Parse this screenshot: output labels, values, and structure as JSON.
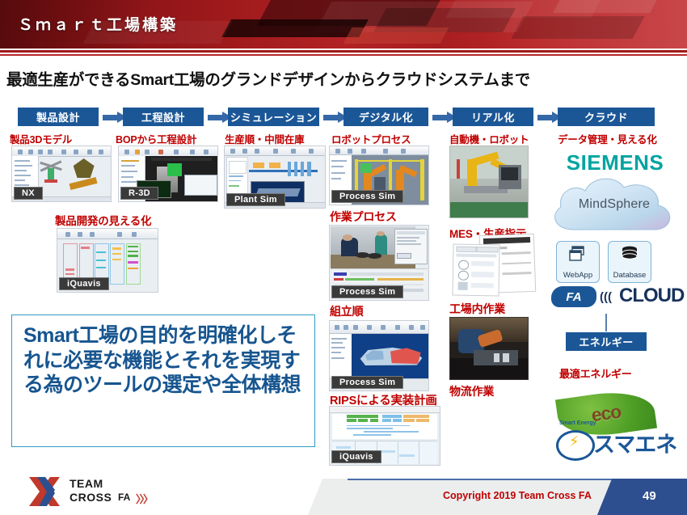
{
  "header": {
    "title": "Ｓｍａｒｔ工場構築"
  },
  "subtitle": "最適生産ができるSmart工場のグランドデザインからクラウドシステムまで",
  "process_steps": [
    {
      "label": "製品設計",
      "sublabel": "製品3Dモデル"
    },
    {
      "label": "工程設計",
      "sublabel": "BOPから工程設計"
    },
    {
      "label": "シミュレーション",
      "sublabel": "生産順・中間在庫"
    },
    {
      "label": "デジタル化",
      "sublabel": "ロボットプロセス"
    },
    {
      "label": "リアル化",
      "sublabel": "自動機・ロボット"
    },
    {
      "label": "クラウド",
      "sublabel": "データ管理・見える化"
    }
  ],
  "tool_tags": {
    "nx": "NX",
    "r3d": "R-3D",
    "plant_sim": "Plant Sim",
    "iquavis": "iQuavis",
    "process_sim": "Process Sim"
  },
  "section_labels": {
    "product_dev_visualization": "製品開発の見える化",
    "work_process": "作業プロセス",
    "assembly_order": "組立順",
    "rips_plan": "RIPSによる実装計画",
    "mes_production": "MES・生産指示",
    "factory_work": "工場内作業",
    "logistics_work": "物流作業",
    "energy_box": "エネルギー",
    "optimal_energy": "最適エネルギー"
  },
  "callout": {
    "text": "Smart工場の目的を明確化しそれに必要な機能とそれを実現する為のツールの選定や全体構想"
  },
  "cloud": {
    "siemens": "SIEMENS",
    "mindsphere": "MindSphere",
    "webapp": "WebApp",
    "database": "Database",
    "fa": "FA",
    "cloud_word": "CLOUD",
    "waves": "((("
  },
  "energy": {
    "eco": "eco",
    "sumaene": "スマエネ",
    "smart_energy": "Smart Energy"
  },
  "footer": {
    "copyright": "Copyright 2019 Team Cross FA",
    "page_number": "49",
    "logo_line1": "TEAM",
    "logo_line2": "CROSS",
    "logo_fa": "FA",
    "logo_chevrons": "〉〉〉"
  },
  "colors": {
    "header_red": "#a01a1c",
    "process_blue": "#1B5797",
    "sublabel_red": "#C00000",
    "callout_border": "#2E9BC4",
    "callout_text": "#17558F",
    "siemens_teal": "#00A4A0",
    "page_tab_blue": "#2E4F8F"
  }
}
